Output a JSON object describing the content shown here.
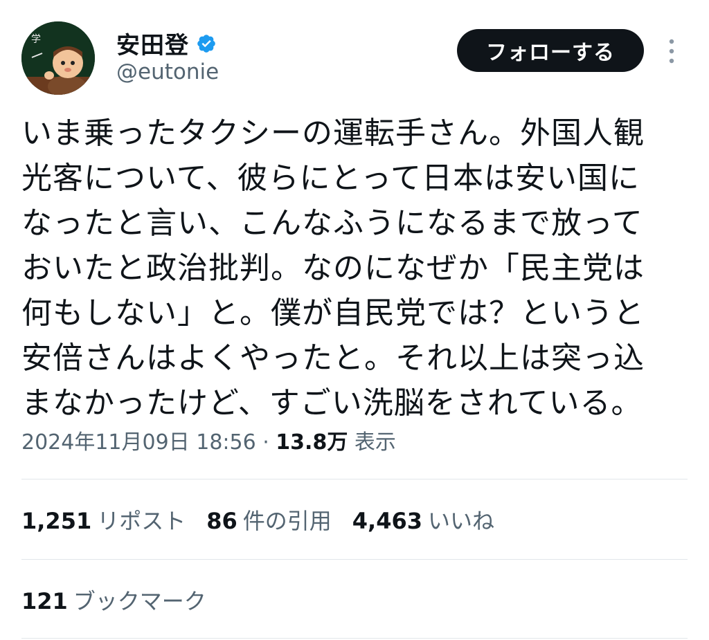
{
  "author": {
    "display_name": "安田登",
    "handle": "@eutonie",
    "verified": true,
    "avatar_icon": "cartoon-teacher-avatar"
  },
  "follow_button": {
    "label": "フォローする"
  },
  "more_menu": {
    "icon": "more-vertical-icon"
  },
  "tweet": {
    "text": "いま乗ったタクシーの運転手さん。外国人観\n光客について、彼らにとって日本は安い国に\nなったと言い、こんなふうになるまで放って\nおいたと政治批判。なのになぜか「民主党は\n何もしない」と。僕が自民党では？というと\n安倍さんはよくやったと。それ以上は突っ込\nまなかったけど、すごい洗脳をされている。",
    "timestamp": "2024年11月09日 18:56",
    "separator": " · ",
    "views_count": "13.8万",
    "views_label": "表示"
  },
  "stats": {
    "reposts": {
      "count": "1,251",
      "label": "リポスト"
    },
    "quotes": {
      "count": "86",
      "label": "件の引用"
    },
    "likes": {
      "count": "4,463",
      "label": "いいね"
    },
    "bookmarks": {
      "count": "121",
      "label": "ブックマーク"
    }
  },
  "colors": {
    "text_primary": "#0f1419",
    "text_secondary": "#536471",
    "verified_blue": "#1d9bf0",
    "button_bg": "#0f1419",
    "divider": "#e1e6ea"
  }
}
